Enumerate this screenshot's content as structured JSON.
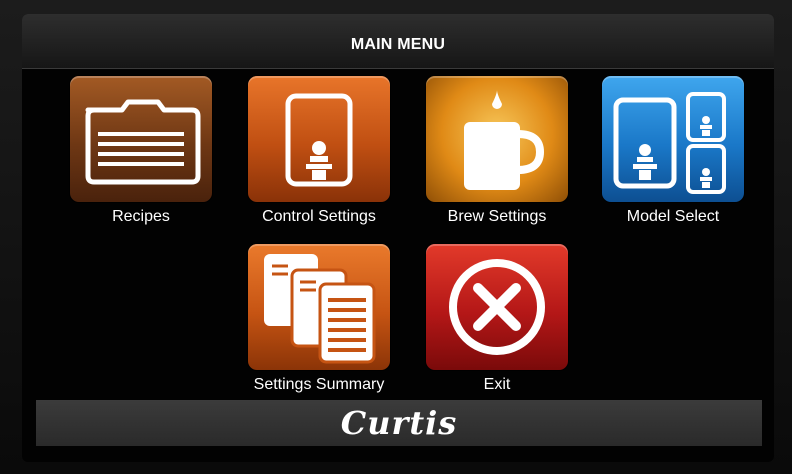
{
  "header": {
    "title": "MAIN MENU"
  },
  "menu": {
    "items": [
      {
        "label": "Recipes",
        "icon": "folder-icon",
        "color": "#8a4a1d"
      },
      {
        "label": "Control Settings",
        "icon": "dispenser-icon",
        "color": "#c75a17"
      },
      {
        "label": "Brew Settings",
        "icon": "mug-icon",
        "color": "#d98e1c"
      },
      {
        "label": "Model Select",
        "icon": "model-select-icon",
        "color": "#1c7fd0"
      },
      {
        "label": "Settings Summary",
        "icon": "documents-icon",
        "color": "#c85a16"
      },
      {
        "label": "Exit",
        "icon": "close-circle-icon",
        "color": "#b81818"
      }
    ]
  },
  "footer": {
    "brand": "Curtis"
  }
}
